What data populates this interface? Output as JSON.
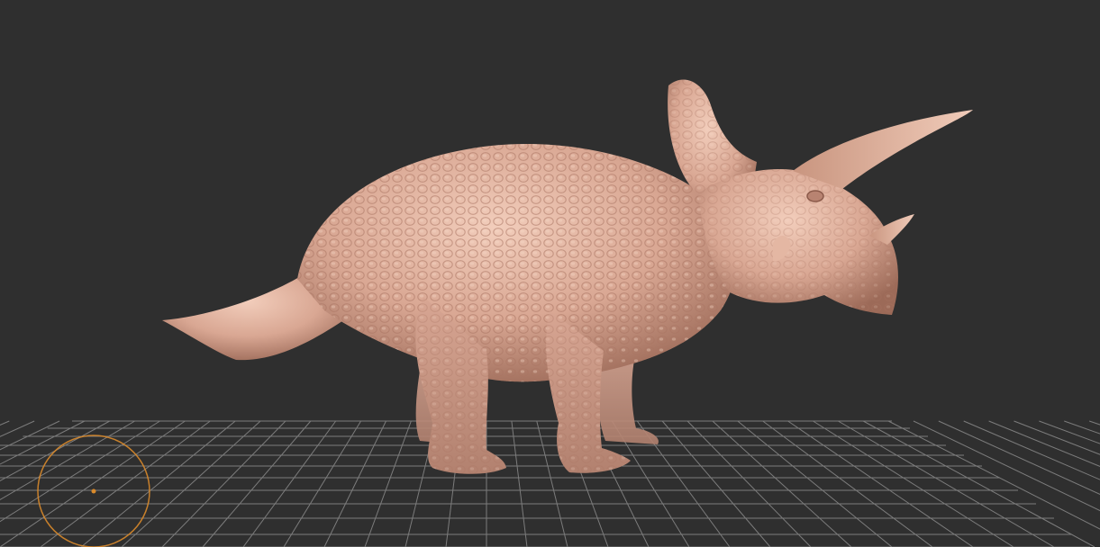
{
  "viewport": {
    "background_color": "#2f2f2f",
    "grid_color": "#8a8a8a",
    "model_color": "#d8a590",
    "model_highlight": "#f1c9b6",
    "model_shadow": "#8d5f4f",
    "brush_cursor_color": "#d98a2b"
  },
  "scene": {
    "model_name": "triceratops-sculpt",
    "floor_grid": "visible",
    "brush_cursor": "circle-icon"
  }
}
